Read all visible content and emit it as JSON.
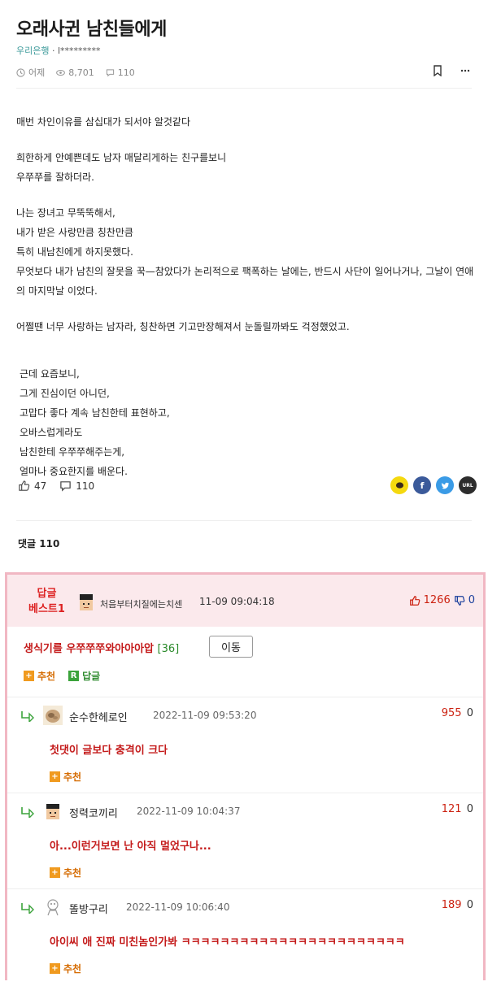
{
  "post": {
    "title": "오래사귄 남친들에게",
    "board": "우리은행",
    "author_masked": "l*********",
    "time": "어제",
    "views": "8,701",
    "comments": "110"
  },
  "body": {
    "p1": "매번 차인이유를 삼십대가 되서야 알것같다",
    "p2a": "희한하게 안예쁜데도 남자 매달리게하는 친구를보니",
    "p2b": "우쭈쭈를 잘하더라.",
    "p3a": "나는 장녀고 무뚝뚝해서,",
    "p3b": "내가 받은 사랑만큼 칭찬만큼",
    "p3c": "특히 내남친에게 하지못했다.",
    "p3d": "무엇보다 내가 남친의 잘못을 꾹—참았다가 논리적으로 팩폭하는 날에는, 반드시 사단이 일어나거나, 그날이 연애의 마지막날 이었다.",
    "p4": "어쩔땐 너무 사랑하는 남자라, 칭찬하면 기고만장해져서 눈돌릴까봐도 걱정했었고.",
    "p5a": "근데 요즘보니,",
    "p5b": "그게 진심이던 아니던,",
    "p5c": "고맙다 좋다 계속 남친한테 표현하고,",
    "p5d": "오바스럽게라도",
    "p5e": "남친한테 우쭈쭈해주는게,",
    "p5f": "얼마나 중요한지를 배운다."
  },
  "reactions": {
    "likes": "47",
    "comments": "110"
  },
  "share": {
    "url_label": "URL"
  },
  "comment_header": "댓글 110",
  "best": {
    "label_line1": "답글",
    "label_line2": "베스트1",
    "nick": "처음부터치질에는치센",
    "time": "11-09 09:04:18",
    "up": "1266",
    "down": "0",
    "text": "생식기를 우쭈쭈쭈와아아아압",
    "reply_count": "[36]",
    "move_label": "이동",
    "recommend_label": "추천",
    "reply_label": "답글"
  },
  "replies": [
    {
      "nick": "순수한헤로인",
      "time": "2022-11-09 09:53:20",
      "up": "955",
      "down": "0",
      "text": "첫댓이 글보다 충격이 크다",
      "recommend_label": "추천"
    },
    {
      "nick": "정력코끼리",
      "time": "2022-11-09 10:04:37",
      "up": "121",
      "down": "0",
      "text": "아...이런거보면 난 아직 멀었구나...",
      "recommend_label": "추천"
    },
    {
      "nick": "똘방구리",
      "time": "2022-11-09 10:06:40",
      "up": "189",
      "down": "0",
      "text": "아이씨 애 진짜 미친놈인가봐 ㅋㅋㅋㅋㅋㅋㅋㅋㅋㅋㅋㅋㅋㅋㅋㅋㅋㅋㅋㅋㅋㅋㅋ",
      "recommend_label": "추천"
    }
  ]
}
